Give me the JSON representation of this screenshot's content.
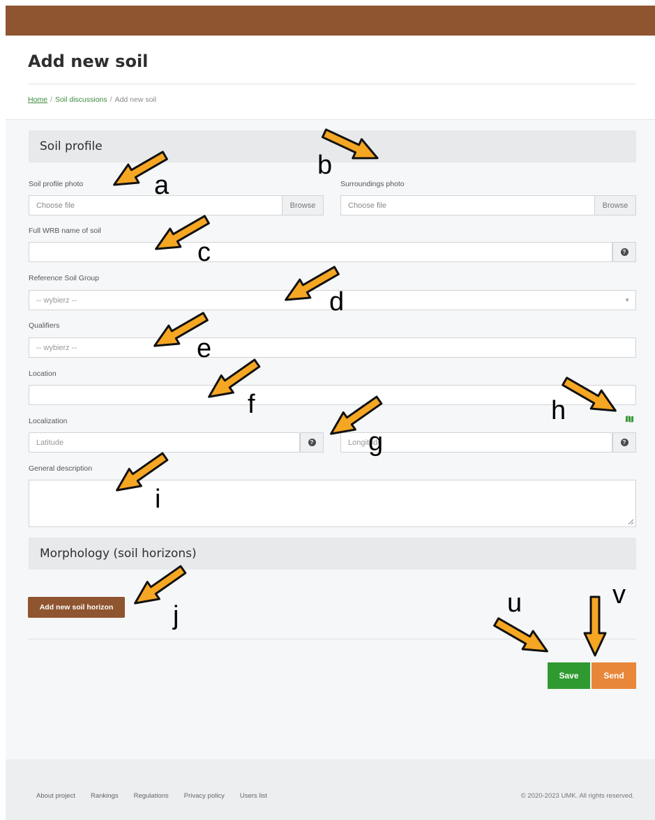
{
  "page": {
    "title": "Add new soil",
    "breadcrumb": {
      "home": "Home",
      "sep": "/",
      "discussions": "Soil discussions",
      "current": "Add new soil"
    }
  },
  "soil_profile": {
    "heading": "Soil profile",
    "profile_photo": {
      "label": "Soil profile photo",
      "placeholder": "Choose file",
      "browse": "Browse"
    },
    "surroundings_photo": {
      "label": "Surroundings photo",
      "placeholder": "Choose file",
      "browse": "Browse"
    },
    "wrb_name": {
      "label": "Full WRB name of soil",
      "value": ""
    },
    "reference_group": {
      "label": "Reference Soil Group",
      "placeholder": "-- wybierz --"
    },
    "qualifiers": {
      "label": "Qualifiers",
      "placeholder": "-- wybierz --"
    },
    "location": {
      "label": "Location",
      "value": ""
    },
    "localization": {
      "label": "Localization",
      "latitude_placeholder": "Latitude",
      "longitude_placeholder": "Longitude"
    },
    "general_description": {
      "label": "General description",
      "value": ""
    }
  },
  "morphology": {
    "heading": "Morphology (soil horizons)",
    "add_button": "Add new soil horizon"
  },
  "actions": {
    "save": "Save",
    "send": "Send"
  },
  "footer": {
    "links": [
      "About project",
      "Rankings",
      "Regulations",
      "Privacy policy",
      "Users list"
    ],
    "copyright": "© 2020-2023 UMK. All rights reserved."
  },
  "annotations": {
    "a": "a",
    "b": "b",
    "c": "c",
    "d": "d",
    "e": "e",
    "f": "f",
    "g": "g",
    "h": "h",
    "i": "i",
    "j": "j",
    "u": "u",
    "v": "v"
  },
  "colors": {
    "brand": "#8f5530",
    "save": "#2f9a2f",
    "send": "#e8873a",
    "annotation_arrow": "#f5a623"
  }
}
